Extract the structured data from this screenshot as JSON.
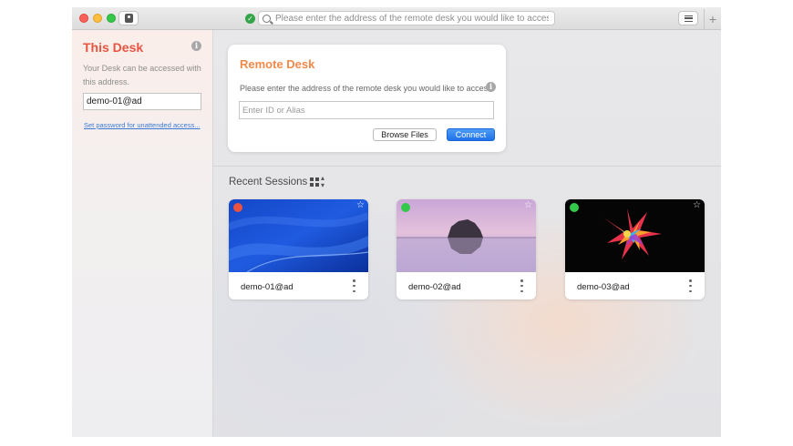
{
  "titlebar": {
    "address_placeholder": "Please enter the address of the remote desk you would like to access."
  },
  "sidebar": {
    "title": "This Desk",
    "description": "Your Desk can be accessed with this address.",
    "desk_id": "demo-01@ad",
    "password_link": "Set password for unattended access..."
  },
  "remote_desk": {
    "title": "Remote Desk",
    "description": "Please enter the address of the remote desk you would like to access.",
    "input_placeholder": "Enter ID or Alias",
    "browse_label": "Browse Files",
    "connect_label": "Connect"
  },
  "recent": {
    "title": "Recent Sessions",
    "sessions": [
      {
        "name": "demo-01@ad",
        "status_color": "#e9533f"
      },
      {
        "name": "demo-02@ad",
        "status_color": "#34c84a"
      },
      {
        "name": "demo-03@ad",
        "status_color": "#34c84a"
      }
    ]
  },
  "icons": {
    "status": "verified-check-icon",
    "search": "search-icon",
    "info": "info-icon",
    "view_toggle": "grid-view-icon",
    "favorite": "star-outline-icon",
    "more": "vertical-ellipsis-icon"
  },
  "colors": {
    "accent_red": "#e85441",
    "accent_orange": "#f08a4b",
    "connect_blue": "#1f72ea",
    "link_blue": "#3a7ad5"
  }
}
